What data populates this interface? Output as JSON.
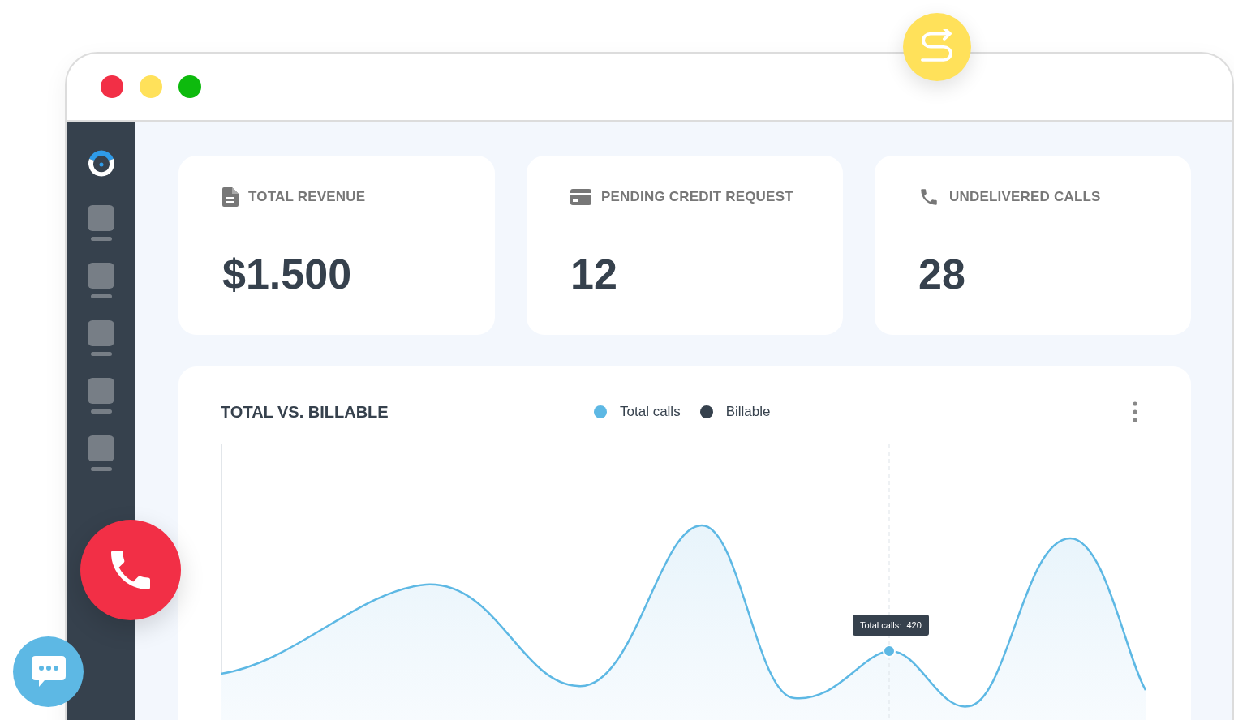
{
  "window": {
    "controls": [
      {
        "color": "#f22f46"
      },
      {
        "color": "#ffe15a"
      },
      {
        "color": "#0dba0d"
      }
    ]
  },
  "sidebar": {
    "items": [
      {
        "kind": "placeholder"
      },
      {
        "kind": "placeholder"
      },
      {
        "kind": "placeholder"
      },
      {
        "kind": "placeholder"
      },
      {
        "kind": "placeholder"
      }
    ]
  },
  "cards": [
    {
      "kind": "document",
      "label": "TOTAL REVENUE",
      "value": "$1.500"
    },
    {
      "kind": "card",
      "label": "PENDING CREDIT REQUEST",
      "value": "12"
    },
    {
      "kind": "phone",
      "label": "UNDELIVERED CALLS",
      "value": "28"
    }
  ],
  "chart": {
    "title": "TOTAL VS. BILLABLE",
    "legend": [
      {
        "label": "Total calls",
        "color": "#5db8e4"
      },
      {
        "label": "Billable",
        "color": "#36414d"
      }
    ],
    "tooltip": "Total calls:  420"
  }
}
